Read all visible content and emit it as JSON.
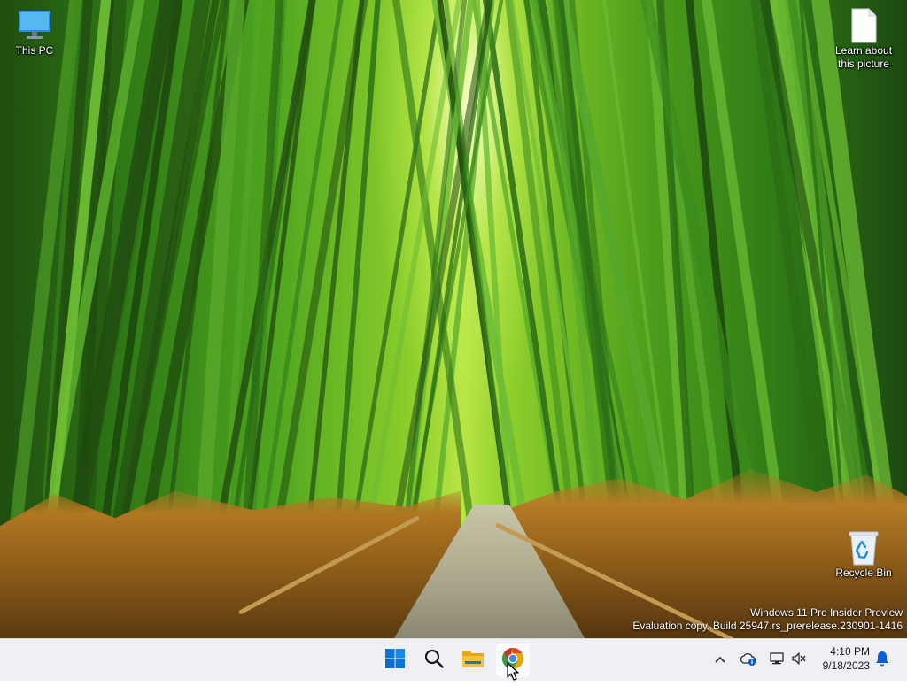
{
  "desktop": {
    "icons": [
      {
        "label": "This PC",
        "icon": "this-pc-icon"
      },
      {
        "label": "Learn about\nthis picture",
        "icon": "document-icon"
      },
      {
        "label": "Recycle Bin",
        "icon": "recycle-bin-icon"
      }
    ]
  },
  "watermark": {
    "line1": "Windows 11 Pro Insider Preview",
    "line2": "Evaluation copy. Build 25947.rs_prerelease.230901-1416"
  },
  "taskbar": {
    "apps": [
      {
        "name": "Start",
        "icon": "windows-start-icon"
      },
      {
        "name": "Search",
        "icon": "search-icon"
      },
      {
        "name": "File Explorer",
        "icon": "file-explorer-icon"
      },
      {
        "name": "Google Chrome Canary",
        "icon": "chrome-canary-icon"
      }
    ],
    "tray": {
      "icons": [
        "chevron-up-icon",
        "onedrive-icon",
        "network-icon",
        "volume-muted-icon",
        "notification-bell-icon"
      ]
    },
    "clock": {
      "time": "4:10 PM",
      "date": "9/18/2023"
    }
  },
  "colors": {
    "taskbar_bg": "#eef0f3",
    "windows_blue": "#0a74d8",
    "folder_yellow": "#f3b824",
    "notification_blue": "#0b5cd6"
  }
}
